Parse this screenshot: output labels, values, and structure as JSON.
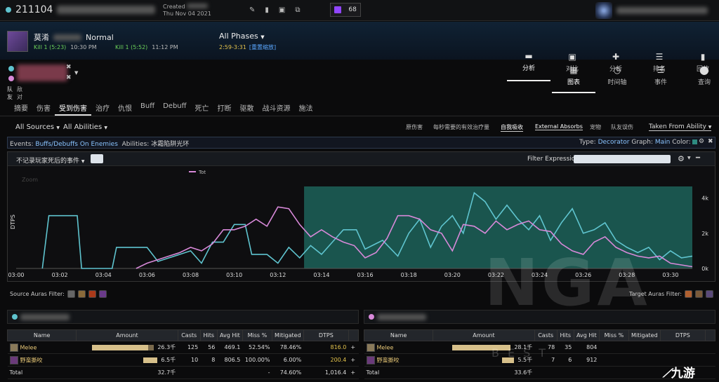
{
  "topbar": {
    "report_id": "211104",
    "created_label": "Created",
    "created_date": "Thu Nov 04 2021",
    "twitch_count": "68"
  },
  "fight": {
    "name_prefix": "莫淆",
    "difficulty": "Normal",
    "kills": [
      {
        "label": "Kill 1 (5:23)",
        "time": "10:30 PM"
      },
      {
        "label": "Kill 1 (5:52)",
        "time": "11:12 PM"
      }
    ],
    "phases_label": "All Phases",
    "phase_time": "2:59-3:31",
    "phase_link": "[重置缩放]"
  },
  "main_nav": [
    {
      "label": "分析",
      "icon": "▬",
      "active": true
    },
    {
      "label": "对比",
      "icon": "▣",
      "active": false
    },
    {
      "label": "分析",
      "icon": "✚",
      "active": false
    },
    {
      "label": "排名",
      "icon": "☰",
      "active": false
    },
    {
      "label": "回放",
      "icon": "▮",
      "active": false
    }
  ],
  "players": {
    "friend_label": "队友",
    "enemy_label": "敌对"
  },
  "view_nav": [
    {
      "label": "图表",
      "icon": "▦",
      "active": true
    },
    {
      "label": "时间轴",
      "icon": "◷",
      "active": false
    },
    {
      "label": "事件",
      "icon": "☰",
      "active": false
    },
    {
      "label": "查询",
      "icon": "⬤",
      "active": false
    }
  ],
  "tabs": [
    {
      "label": "摘要",
      "active": false
    },
    {
      "label": "伤害",
      "active": false
    },
    {
      "label": "受到伤害",
      "active": true
    },
    {
      "label": "治疗",
      "active": false
    },
    {
      "label": "仇恨",
      "active": false
    },
    {
      "label": "Buff",
      "active": false
    },
    {
      "label": "Debuff",
      "active": false
    },
    {
      "label": "死亡",
      "active": false
    },
    {
      "label": "打断",
      "active": false
    },
    {
      "label": "驱散",
      "active": false
    },
    {
      "label": "战斗资源",
      "active": false
    },
    {
      "label": "施法",
      "active": false
    }
  ],
  "filters": {
    "sources": "All Sources",
    "abilities": "All Abilities",
    "options": [
      {
        "label": "原伤害",
        "selected": false
      },
      {
        "label": "每秒需要的有效治疗量",
        "selected": false
      },
      {
        "label": "自我吸收",
        "selected": true
      },
      {
        "label": "External Absorbs",
        "selected": true
      },
      {
        "label": "宠物",
        "selected": false
      },
      {
        "label": "队友误伤",
        "selected": false
      }
    ],
    "taken_from": "Taken From Ability"
  },
  "events_bar": {
    "events_label": "Events:",
    "events_value": "Buffs/Debuffs On Enemies",
    "abilities_label": "Abilities:",
    "abilities_value": "冰霜陷阱光环",
    "type_label": "Type:",
    "type_value": "Decorator",
    "graph_label": "Graph:",
    "graph_value": "Main",
    "color_label": "Color:"
  },
  "graph_head": {
    "death_filter": "不记录玩家死后的事件",
    "filter_label": "Filter Expression:"
  },
  "chart_data": {
    "type": "line",
    "ylabel": "DTPS",
    "legend": "Tot",
    "zoom_label": "Zoom",
    "x_tick_labels": [
      "03:00",
      "03:02",
      "03:04",
      "03:06",
      "03:08",
      "03:10",
      "03:12",
      "03:14",
      "03:16",
      "03:18",
      "03:20",
      "03:22",
      "03:24",
      "03:26",
      "03:28",
      "03:30"
    ],
    "y_tick_labels": [
      "4k",
      "2k",
      "0k"
    ],
    "ylim": [
      0,
      5500
    ],
    "xlim": [
      180,
      211
    ],
    "highlight_range": [
      193.2,
      211
    ],
    "series": [
      {
        "color": "#5fc4cf",
        "points": [
          [
            181.2,
            0
          ],
          [
            181.5,
            3000
          ],
          [
            182.8,
            3000
          ],
          [
            183,
            0
          ],
          [
            184.4,
            0
          ],
          [
            184.6,
            1200
          ],
          [
            186,
            1200
          ],
          [
            186.5,
            400
          ],
          [
            188,
            1000
          ],
          [
            188.5,
            300
          ],
          [
            189,
            1500
          ],
          [
            189.5,
            1500
          ],
          [
            190,
            2500
          ],
          [
            190.5,
            2500
          ],
          [
            190.8,
            800
          ],
          [
            191.5,
            800
          ],
          [
            192,
            300
          ],
          [
            192.5,
            1200
          ],
          [
            193,
            600
          ],
          [
            193.5,
            1300
          ],
          [
            194,
            800
          ],
          [
            194.5,
            1500
          ],
          [
            195,
            2200
          ],
          [
            195.6,
            2200
          ],
          [
            196,
            1100
          ],
          [
            196.8,
            1600
          ],
          [
            197.5,
            700
          ],
          [
            198,
            2000
          ],
          [
            198.5,
            2800
          ],
          [
            199,
            1200
          ],
          [
            199.5,
            2400
          ],
          [
            200,
            3000
          ],
          [
            200.5,
            2000
          ],
          [
            201,
            4300
          ],
          [
            201.5,
            3800
          ],
          [
            202,
            2800
          ],
          [
            202.5,
            3600
          ],
          [
            203,
            2800
          ],
          [
            203.5,
            2200
          ],
          [
            204,
            3000
          ],
          [
            204.5,
            1600
          ],
          [
            205,
            2600
          ],
          [
            205.5,
            3400
          ],
          [
            206,
            2000
          ],
          [
            206.5,
            2200
          ],
          [
            207,
            2600
          ],
          [
            207.5,
            1600
          ],
          [
            208,
            1200
          ],
          [
            208.5,
            900
          ],
          [
            209,
            1200
          ],
          [
            209.5,
            500
          ],
          [
            210,
            1000
          ],
          [
            210.5,
            600
          ],
          [
            211,
            700
          ]
        ]
      },
      {
        "color": "#d889d9",
        "points": [
          [
            185.5,
            0
          ],
          [
            186,
            300
          ],
          [
            186.5,
            500
          ],
          [
            187,
            700
          ],
          [
            187.5,
            900
          ],
          [
            188,
            1200
          ],
          [
            188.5,
            1000
          ],
          [
            189,
            1400
          ],
          [
            189.5,
            2200
          ],
          [
            190,
            2200
          ],
          [
            190.5,
            2400
          ],
          [
            191,
            2800
          ],
          [
            191.5,
            2400
          ],
          [
            192,
            3500
          ],
          [
            192.5,
            3400
          ],
          [
            193,
            2500
          ],
          [
            193.5,
            1800
          ],
          [
            194,
            2200
          ],
          [
            194.5,
            1800
          ],
          [
            195,
            1500
          ],
          [
            195.5,
            1300
          ],
          [
            196,
            600
          ],
          [
            196.5,
            900
          ],
          [
            197,
            1700
          ],
          [
            197.5,
            3000
          ],
          [
            198,
            3000
          ],
          [
            198.5,
            2800
          ],
          [
            199,
            2200
          ],
          [
            199.5,
            2000
          ],
          [
            200,
            1000
          ],
          [
            200.5,
            2500
          ],
          [
            201,
            2400
          ],
          [
            201.5,
            2000
          ],
          [
            202,
            2700
          ],
          [
            202.5,
            2200
          ],
          [
            203,
            2500
          ],
          [
            203.5,
            2700
          ],
          [
            204,
            2200
          ],
          [
            204.5,
            2100
          ],
          [
            205,
            1400
          ],
          [
            205.5,
            1000
          ],
          [
            206,
            800
          ],
          [
            206.5,
            1500
          ],
          [
            207,
            1800
          ],
          [
            207.5,
            1200
          ],
          [
            208,
            900
          ],
          [
            208.5,
            700
          ],
          [
            209,
            600
          ],
          [
            209.5,
            700
          ],
          [
            210,
            300
          ],
          [
            210.5,
            200
          ],
          [
            211,
            100
          ]
        ]
      }
    ]
  },
  "auras": {
    "source_label": "Source Auras Filter:",
    "target_label": "Target Auras Filter:"
  },
  "table_columns": [
    "Name",
    "Amount",
    "Casts",
    "Hits",
    "Avg Hit",
    "Miss %",
    "Mitigated",
    "DTPS"
  ],
  "left_table": {
    "rows": [
      {
        "name": "Melee",
        "amount": "26.3千",
        "casts": "125",
        "hits": "56",
        "avg_hit": "469.1",
        "miss": "52.54%",
        "mitigated": "78.46%",
        "dtps": "816.0",
        "bar_fraction": 0.8
      },
      {
        "name": "野蛮撕咬",
        "amount": "6.5千",
        "casts": "10",
        "hits": "8",
        "avg_hit": "806.5",
        "miss": "100.00%",
        "mitigated": "6.00%",
        "dtps": "200.4",
        "bar_fraction": 0.2
      }
    ],
    "total": {
      "label": "Total",
      "amount": "32.7千",
      "miss": "-",
      "mitigated": "74.60%",
      "dtps": "1,016.4"
    }
  },
  "right_table": {
    "rows": [
      {
        "name": "Melee",
        "amount": "28.1千",
        "casts": "78",
        "hits": "35",
        "avg_hit": "804",
        "bar_fraction": 0.83
      },
      {
        "name": "野蛮撕咬",
        "amount": "5.5千",
        "casts": "7",
        "hits": "6",
        "avg_hit": "912",
        "bar_fraction": 0.17
      }
    ],
    "total": {
      "label": "Total",
      "amount": "33.6千"
    }
  },
  "watermark": {
    "text": "NGA",
    "sub": "BEST",
    "brand": "九游"
  },
  "colors": {
    "accent": "#3aa0ff",
    "kill_green": "#6bd15a",
    "highlight": "#1f7a6c",
    "bar": "#d7c08a"
  }
}
